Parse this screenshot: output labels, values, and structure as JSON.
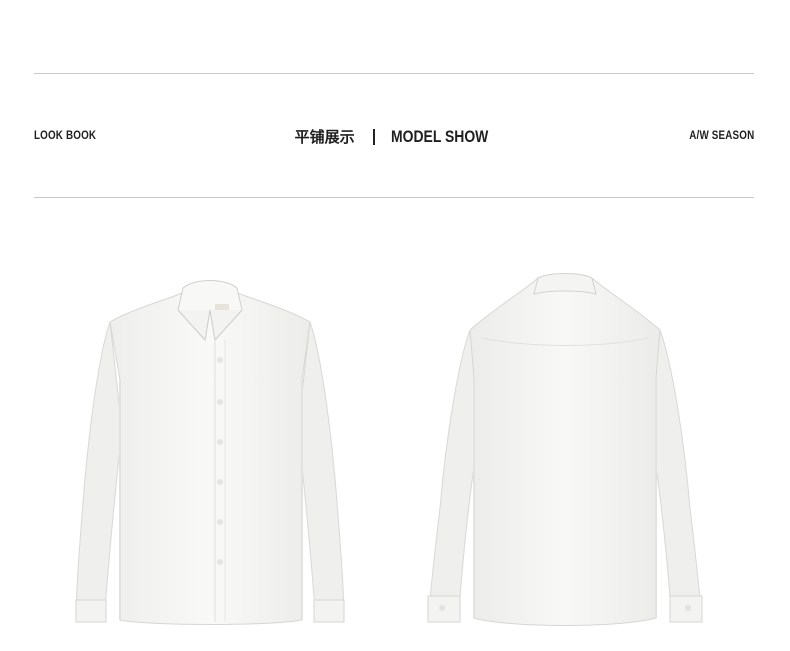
{
  "header": {
    "left_label": "LOOK BOOK",
    "center_cn": "平铺展示",
    "center_en": "MODEL SHOW",
    "right_label": "A/W SEASON"
  },
  "product": {
    "views": [
      {
        "name": "front",
        "color": "#f7f7f5"
      },
      {
        "name": "back",
        "color": "#f7f7f5"
      }
    ]
  }
}
